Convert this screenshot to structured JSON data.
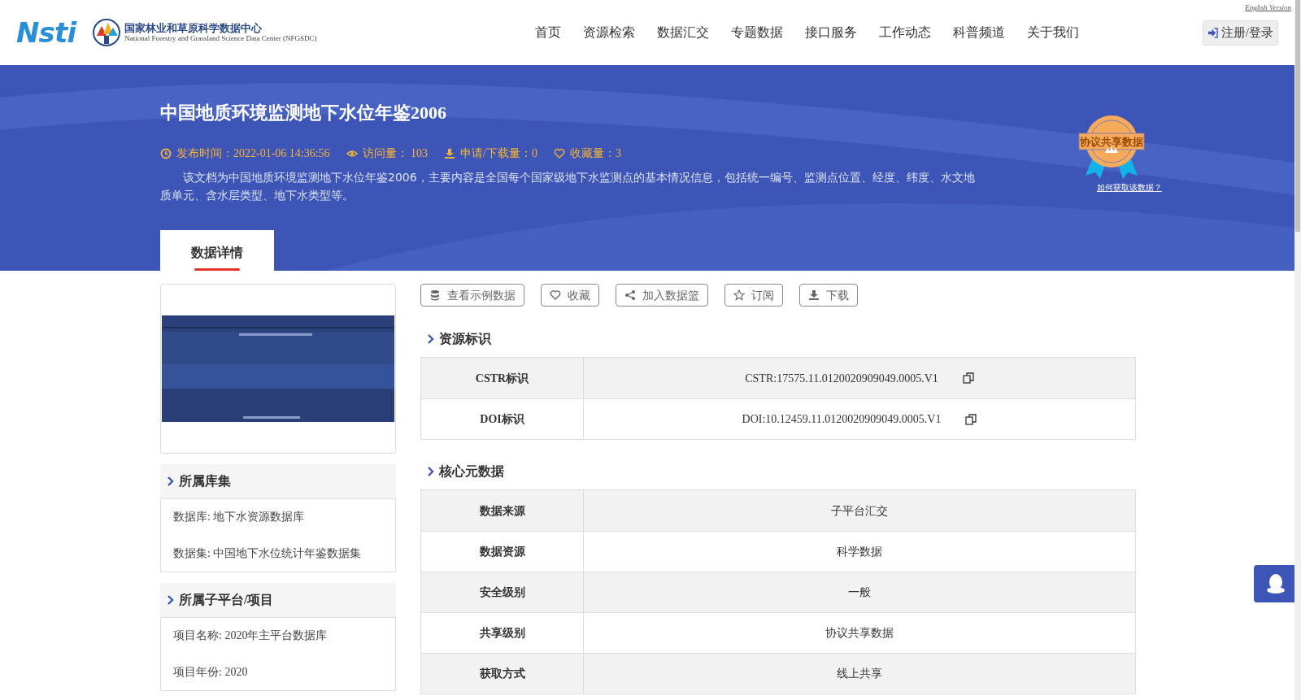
{
  "header": {
    "logo_text": "Nsti",
    "org_name": "国家林业和草原科学数据中心",
    "org_name_en": "National Forestry and Grassland Science Data Center (NFGSDC)",
    "language_link": "English Version",
    "nav": [
      {
        "label": "首页",
        "selected": false
      },
      {
        "label": "资源检索",
        "selected": false
      },
      {
        "label": "数据汇交",
        "selected": false
      },
      {
        "label": "专题数据",
        "selected": false
      },
      {
        "label": "接口服务",
        "selected": false
      },
      {
        "label": "工作动态",
        "selected": false
      },
      {
        "label": "科普频道",
        "selected": false
      },
      {
        "label": "关于我们",
        "selected": false
      }
    ],
    "login_button": "注册/登录"
  },
  "banner": {
    "title": "中国地质环境监测地下水位年鉴2006",
    "meta": [
      {
        "kind": "clock",
        "text": "发布时间：2022-01-06 14:36:56"
      },
      {
        "kind": "eye",
        "text": "访问量： 103"
      },
      {
        "kind": "download",
        "text": "申请/下载量：0"
      },
      {
        "kind": "heart",
        "text": "收藏量：3"
      }
    ],
    "description": "该文档为中国地质环境监测地下水位年鉴2006，主要内容是全国每个国家级地下水监测点的基本情况信息，包括统一编号、监测点位置、经度、纬度、水文地质单元、含水层类型、地下水类型等。",
    "badge_text": "协议共享数据",
    "badge_link": "如何获取该数据？",
    "tabs": [
      {
        "label": "数据详情",
        "selected": true
      }
    ]
  },
  "sidebar": {
    "sections": [
      {
        "title": "所属库集",
        "items": [
          "数据库: 地下水资源数据库",
          "数据集: 中国地下水位统计年鉴数据集"
        ]
      },
      {
        "title": "所属子平台/项目",
        "items": [
          "项目名称: 2020年主平台数据库",
          "项目年份: 2020"
        ]
      }
    ]
  },
  "actions": [
    {
      "kind": "database",
      "label": "查看示例数据"
    },
    {
      "kind": "heart",
      "label": "收藏"
    },
    {
      "kind": "share",
      "label": "加入数据篮"
    },
    {
      "kind": "star",
      "label": "订阅"
    },
    {
      "kind": "download",
      "label": "下载"
    }
  ],
  "sections": [
    {
      "title": "资源标识",
      "rows": [
        {
          "label": "CSTR标识",
          "value": "CSTR:17575.11.0120020909049.0005.V1",
          "copy": true
        },
        {
          "label": "DOI标识",
          "value": "DOI:10.12459.11.0120020909049.0005.V1",
          "copy": true
        }
      ]
    },
    {
      "title": "核心元数据",
      "rows": [
        {
          "label": "数据来源",
          "value": "子平台汇交",
          "copy": false
        },
        {
          "label": "数据资源",
          "value": "科学数据",
          "copy": false
        },
        {
          "label": "安全级别",
          "value": "一般",
          "copy": false
        },
        {
          "label": "共享级别",
          "value": "协议共享数据",
          "copy": false
        },
        {
          "label": "获取方式",
          "value": "线上共享",
          "copy": false
        }
      ]
    }
  ]
}
